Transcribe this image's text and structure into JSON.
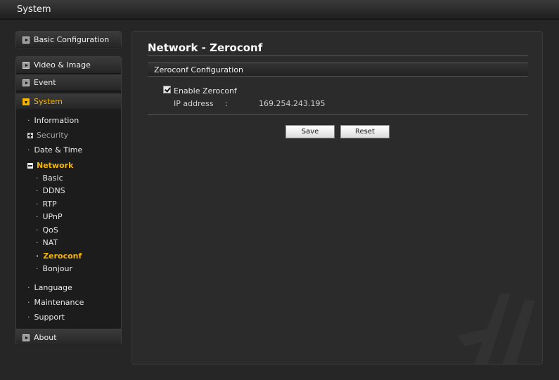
{
  "window": {
    "title": "System"
  },
  "sidebar": {
    "basic_configuration": "Basic Configuration",
    "video_image": "Video & Image",
    "event": "Event",
    "system": "System",
    "system_items": {
      "information": "Information",
      "security": "Security",
      "date_time": "Date & Time",
      "network": "Network",
      "network_items": [
        "Basic",
        "DDNS",
        "RTP",
        "UPnP",
        "QoS",
        "NAT",
        "Zeroconf",
        "Bonjour"
      ],
      "language": "Language",
      "maintenance": "Maintenance",
      "support": "Support"
    },
    "about": "About"
  },
  "main": {
    "title": "Network - Zeroconf",
    "section": "Zeroconf Configuration",
    "enable_label": "Enable Zeroconf",
    "enable_checked": true,
    "ip_label": "IP address",
    "ip_sep": ":",
    "ip_value": "169.254.243.195",
    "save_label": "Save",
    "reset_label": "Reset"
  },
  "colors": {
    "accent": "#f5b400",
    "background": "#262626",
    "panel": "#2b2b2b"
  }
}
